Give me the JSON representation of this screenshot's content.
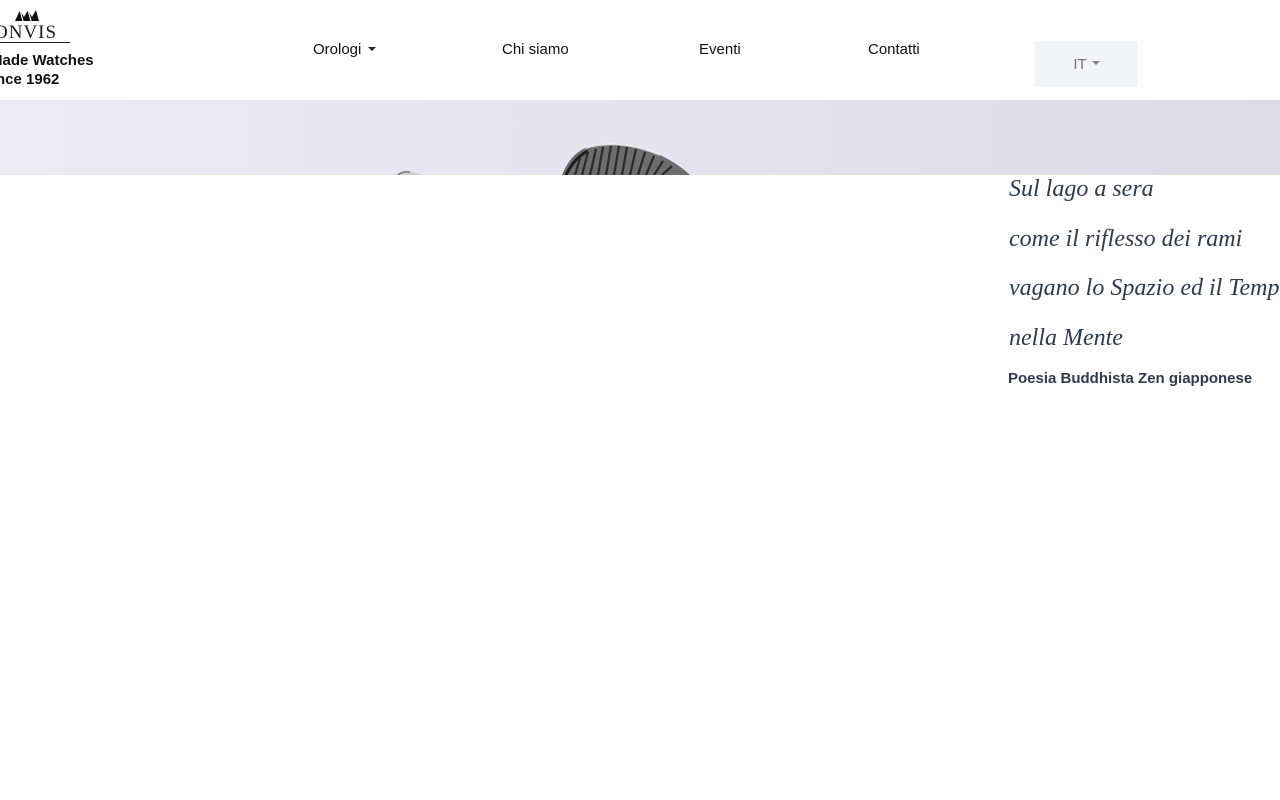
{
  "brand": {
    "name": "ONVIS",
    "tagline_line1": "Made Watches",
    "tagline_line2": "nce 1962",
    "logo_icon": "double-peak-logo-icon"
  },
  "nav": {
    "items": [
      {
        "label": "Orologi",
        "has_dropdown": true
      },
      {
        "label": "Chi siamo",
        "has_dropdown": false
      },
      {
        "label": "Eventi",
        "has_dropdown": false
      },
      {
        "label": "Contatti",
        "has_dropdown": false
      }
    ]
  },
  "language": {
    "current": "IT",
    "has_dropdown": true
  },
  "hero": {
    "image_icon": "watch-bezel-photo"
  },
  "poem": {
    "lines": [
      "Sul lago a sera",
      "come il riflesso dei rami",
      "vagano lo Spazio ed il Temp",
      "nella Mente"
    ],
    "credit": "Poesia Buddhista Zen giapponese"
  },
  "colors": {
    "text_dark": "#111111",
    "poem_text": "#2e3a4d",
    "lang_bg": "#f2f4f8",
    "hero_bg": "#e5e3ef"
  }
}
